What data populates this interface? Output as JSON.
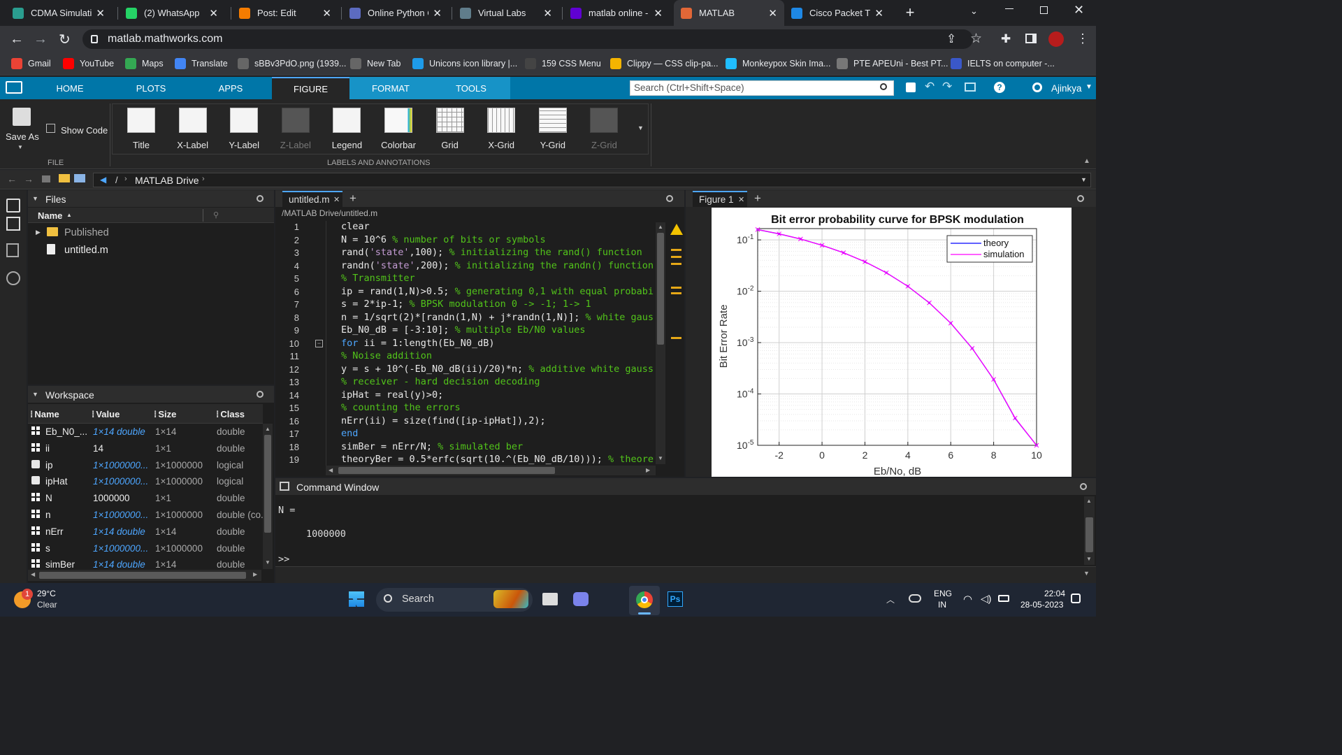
{
  "browser": {
    "tabs": [
      {
        "title": "CDMA Simulation",
        "icon": "cdma-icon",
        "color": "#2a9d8f"
      },
      {
        "title": "(2) WhatsApp",
        "icon": "whatsapp-icon",
        "color": "#25d366"
      },
      {
        "title": "Post: Edit",
        "icon": "blogger-icon",
        "color": "#f57c00"
      },
      {
        "title": "Online Python Co",
        "icon": "python-icon",
        "color": "#5c6bc0"
      },
      {
        "title": "Virtual Labs",
        "icon": "virtual-labs-icon",
        "color": "#607d8b"
      },
      {
        "title": "matlab online - Y",
        "icon": "yahoo-icon",
        "color": "#6001d2"
      },
      {
        "title": "MATLAB",
        "icon": "matlab-icon",
        "color": "#e16737"
      },
      {
        "title": "Cisco Packet Trac",
        "icon": "cisco-icon",
        "color": "#1e88e5"
      }
    ],
    "url": "matlab.mathworks.com",
    "bookmarks": [
      {
        "label": "Gmail",
        "color": "#ea4335"
      },
      {
        "label": "YouTube",
        "color": "#ff0000"
      },
      {
        "label": "Maps",
        "color": "#34a853"
      },
      {
        "label": "Translate",
        "color": "#4285f4"
      },
      {
        "label": "sBBv3PdO.png (1939...",
        "color": "#666666"
      },
      {
        "label": "New Tab",
        "color": "#666666"
      },
      {
        "label": "Unicons icon library |...",
        "color": "#1e9be9"
      },
      {
        "label": "159 CSS Menu",
        "color": "#444444"
      },
      {
        "label": "Clippy — CSS clip-pa...",
        "color": "#f4b400"
      },
      {
        "label": "Monkeypox Skin Ima...",
        "color": "#20beff"
      },
      {
        "label": "PTE APEUni - Best PT...",
        "color": "#777777"
      },
      {
        "label": "IELTS on computer -...",
        "color": "#3a58c9"
      }
    ]
  },
  "matlab": {
    "nav": [
      "HOME",
      "PLOTS",
      "APPS",
      "FIGURE",
      "FORMAT",
      "TOOLS"
    ],
    "search_placeholder": "Search (Ctrl+Shift+Space)",
    "user": "Ajinkya",
    "file_section": {
      "save_as": "Save As",
      "show_code": "Show Code",
      "section": "FILE"
    },
    "tools": [
      "Title",
      "X-Label",
      "Y-Label",
      "Z-Label",
      "Legend",
      "Colorbar",
      "Grid",
      "X-Grid",
      "Y-Grid",
      "Z-Grid"
    ],
    "tools_section": "LABELS AND ANNOTATIONS",
    "path": {
      "sep": "/",
      "drive": "MATLAB Drive"
    },
    "files": {
      "title": "Files",
      "col_name": "Name",
      "items": [
        "Published",
        "untitled.m"
      ]
    },
    "workspace": {
      "title": "Workspace",
      "cols": [
        "Name",
        "Value",
        "Size",
        "Class"
      ],
      "rows": [
        {
          "name": "Eb_N0_...",
          "value": "1×14 double",
          "size": "1×14",
          "class": "double",
          "link": true,
          "icon": "grid"
        },
        {
          "name": "ii",
          "value": "14",
          "size": "1×1",
          "class": "double",
          "link": false,
          "icon": "grid"
        },
        {
          "name": "ip",
          "value": "1×1000000...",
          "size": "1×1000000",
          "class": "logical",
          "link": true,
          "icon": "check"
        },
        {
          "name": "ipHat",
          "value": "1×1000000...",
          "size": "1×1000000",
          "class": "logical",
          "link": true,
          "icon": "check"
        },
        {
          "name": "N",
          "value": "1000000",
          "size": "1×1",
          "class": "double",
          "link": false,
          "icon": "grid"
        },
        {
          "name": "n",
          "value": "1×1000000...",
          "size": "1×1000000",
          "class": "double (co...",
          "link": true,
          "icon": "grid"
        },
        {
          "name": "nErr",
          "value": "1×14 double",
          "size": "1×14",
          "class": "double",
          "link": true,
          "icon": "grid"
        },
        {
          "name": "s",
          "value": "1×1000000...",
          "size": "1×1000000",
          "class": "double",
          "link": true,
          "icon": "grid"
        },
        {
          "name": "simBer",
          "value": "1×14 double",
          "size": "1×14",
          "class": "double",
          "link": true,
          "icon": "grid"
        }
      ]
    },
    "editor": {
      "tab": "untitled.m",
      "path": "/MATLAB Drive/untitled.m",
      "lines": [
        "clear",
        "N = 10^6 % number of bits or symbols",
        "rand('state',100); % initializing the rand() function",
        "randn('state',200); % initializing the randn() function",
        "% Transmitter",
        "ip = rand(1,N)>0.5; % generating 0,1 with equal probabili",
        "s = 2*ip-1; % BPSK modulation 0 -> -1; 1-> 1",
        "n = 1/sqrt(2)*[randn(1,N) + j*randn(1,N)]; % white gaussi",
        "Eb_N0_dB = [-3:10]; % multiple Eb/N0 values",
        "for ii = 1:length(Eb_N0_dB)",
        "% Noise addition",
        "y = s + 10^(-Eb_N0_dB(ii)/20)*n; % additive white gaussia",
        "% receiver - hard decision decoding",
        "ipHat = real(y)>0;",
        "% counting the errors",
        "nErr(ii) = size(find([ip-ipHat]),2);",
        "end",
        "simBer = nErr/N; % simulated ber",
        "theoryBer = 0.5*erfc(sqrt(10.^(Eb_N0_dB/10))); % theoreti"
      ]
    },
    "command_window": {
      "title": "Command Window",
      "out1": "N =",
      "out2": "1000000",
      "prompt": ">>"
    },
    "figure": {
      "tab": "Figure 1"
    }
  },
  "chart_data": {
    "type": "line",
    "title": "Bit error probability curve for BPSK modulation",
    "xlabel": "Eb/No, dB",
    "ylabel": "Bit Error Rate",
    "xlim": [
      -3,
      10
    ],
    "ylim": [
      1e-05,
      1
    ],
    "yscale": "log",
    "grid": true,
    "legend_position": "top-right",
    "x": [
      -3,
      -2,
      -1,
      0,
      1,
      2,
      3,
      4,
      5,
      6,
      7,
      8,
      9,
      10
    ],
    "series": [
      {
        "name": "theory",
        "color": "#0000ff",
        "marker": ".",
        "values": [
          0.1587,
          0.1309,
          0.104,
          0.0786,
          0.0563,
          0.0375,
          0.0229,
          0.0125,
          0.00595,
          0.00239,
          0.000773,
          0.000191,
          3.36e-05,
          3.87e-06
        ]
      },
      {
        "name": "simulation",
        "color": "#ff00ff",
        "marker": "x",
        "values": [
          0.1588,
          0.131,
          0.104,
          0.0786,
          0.0563,
          0.0376,
          0.0229,
          0.0125,
          0.00596,
          0.00239,
          0.000775,
          0.000192,
          3.4e-05,
          3.6e-06
        ]
      }
    ],
    "xticks": [
      "-2",
      "0",
      "2",
      "4",
      "6",
      "8",
      "10"
    ],
    "yticks": [
      "10",
      "10",
      "10",
      "10",
      "10"
    ],
    "yticks_exp": [
      "-1",
      "-2",
      "-3",
      "-4",
      "-5"
    ]
  },
  "taskbar": {
    "temp": "29°C",
    "weather": "Clear",
    "search": "Search",
    "lang1": "ENG",
    "lang2": "IN",
    "time": "22:04",
    "date": "28-05-2023",
    "weather_badge": "1"
  }
}
